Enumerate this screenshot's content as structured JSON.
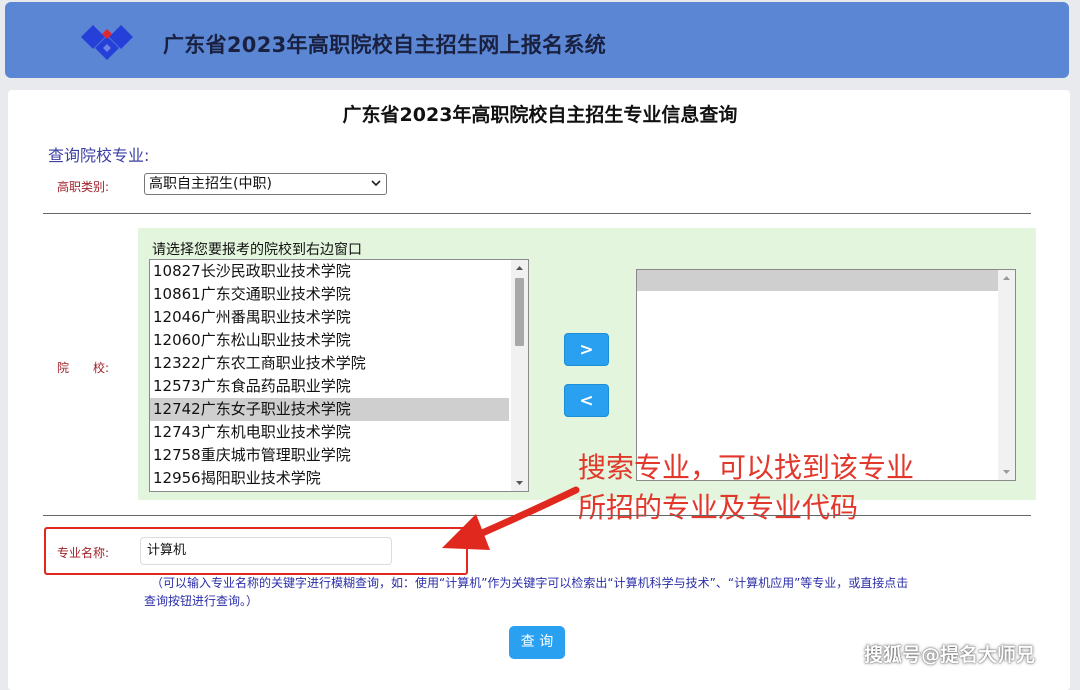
{
  "header": {
    "app_title": "广东省2023年高职院校自主招生网上报名系统",
    "logo_colors": [
      "#2540d8",
      "#e0282e"
    ]
  },
  "page": {
    "title": "广东省2023年高职院校自主招生专业信息查询",
    "section_label": "查询院校专业:"
  },
  "form": {
    "category_label": "高职类别:",
    "category_value": "高职自主招生(中职)",
    "school_label": "院　　校:",
    "list_hint": "请选择您要报考的院校到右边窗口",
    "schools": [
      "10827长沙民政职业技术学院",
      "10861广东交通职业技术学院",
      "12046广州番禺职业技术学院",
      "12060广东松山职业技术学院",
      "12322广东农工商职业技术学院",
      "12573广东食品药品职业学院",
      "12742广东女子职业技术学院",
      "12743广东机电职业技术学院",
      "12758重庆城市管理职业学院",
      "12956揭阳职业技术学院"
    ],
    "selected_index": 6,
    "add_button": ">",
    "remove_button": "<",
    "major_label": "专业名称:",
    "major_value": "计算机",
    "help_line1": "（可以输入专业名称的关键字进行模糊查询，如：使用“计算机”作为关键字可以检索出“计算机科学与技术”、“计算机应用”等专业，或直接点击",
    "help_line2": "查询按钮进行查询。）",
    "query_button": "查 询"
  },
  "annotation": {
    "line1": "搜索专业，可以找到该专业",
    "line2": "所招的专业及专业代码",
    "color": "#e2372b"
  },
  "watermark": "搜狐号@提名大师兄"
}
